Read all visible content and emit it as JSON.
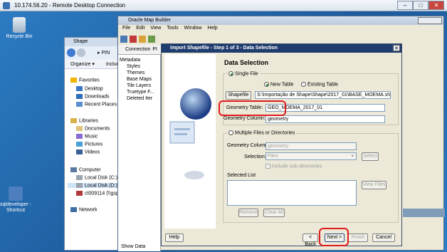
{
  "rdp": {
    "title": "10.174.56.20 - Remote Desktop Connection"
  },
  "desktop": {
    "icons": [
      {
        "label": "Recycle Bin"
      },
      {
        "label": "sqldeveloper - Shortcut"
      }
    ]
  },
  "explorer": {
    "title": "Shape",
    "breadcrumb": "▸ PIN",
    "organize": "Organize ▾",
    "include": "Include",
    "nav": [
      "Favorites",
      "Desktop",
      "Downloads",
      "Recent Places",
      "Libraries",
      "Documents",
      "Music",
      "Pictures",
      "Videos",
      "Computer",
      "Local Disk (C:)",
      "Local Disk (D:)",
      "ct009114 (\\\\gsp",
      "Network"
    ]
  },
  "mapbuilder": {
    "title": "Oracle Map Builder",
    "menu": [
      "File",
      "Edit",
      "View",
      "Tools",
      "Window",
      "Help"
    ],
    "connection_tab": "Connection",
    "tab_suffix": "PI",
    "tree": [
      "Metadata",
      "Styles",
      "Themes",
      "Base Maps",
      "Tile Layers",
      "Truetype F...",
      "Deleted Iter"
    ],
    "show_data": "Show Data"
  },
  "dialog": {
    "title": "Import Shapefile - Step 1 of 3 - Data Selection",
    "heading": "Data Selection",
    "single_file": "Single File",
    "new_table": "New Table",
    "existing_table": "Existing Table",
    "shapefile_button": "Shapefile",
    "shapefile_path": "S:\\Importação de Shape\\Shape\\2017_01\\BASE_MOEMA.shp",
    "geometry_table_label": "Geometry Table:",
    "geometry_table_value": "GEO_MOEMA_2017_01",
    "geometry_column_label": "Geometry Column:",
    "geometry_column_value": "geometry",
    "multiple_files": "Multiple Files or Directories",
    "multi_geometry_column_label": "Geometry Column:",
    "multi_geometry_column_value": "geometry",
    "selection_label": "Selection:",
    "selection_value": "Files",
    "select_button": "Select",
    "include_subdirs": "Include sub-directories",
    "selected_list": "Selected List",
    "view_files": "View Files",
    "remove": "Remove",
    "clear_all": "Clear All",
    "help": "Help",
    "back": "< Back",
    "next": "Next >",
    "finish": "Finish",
    "cancel": "Cancel"
  }
}
